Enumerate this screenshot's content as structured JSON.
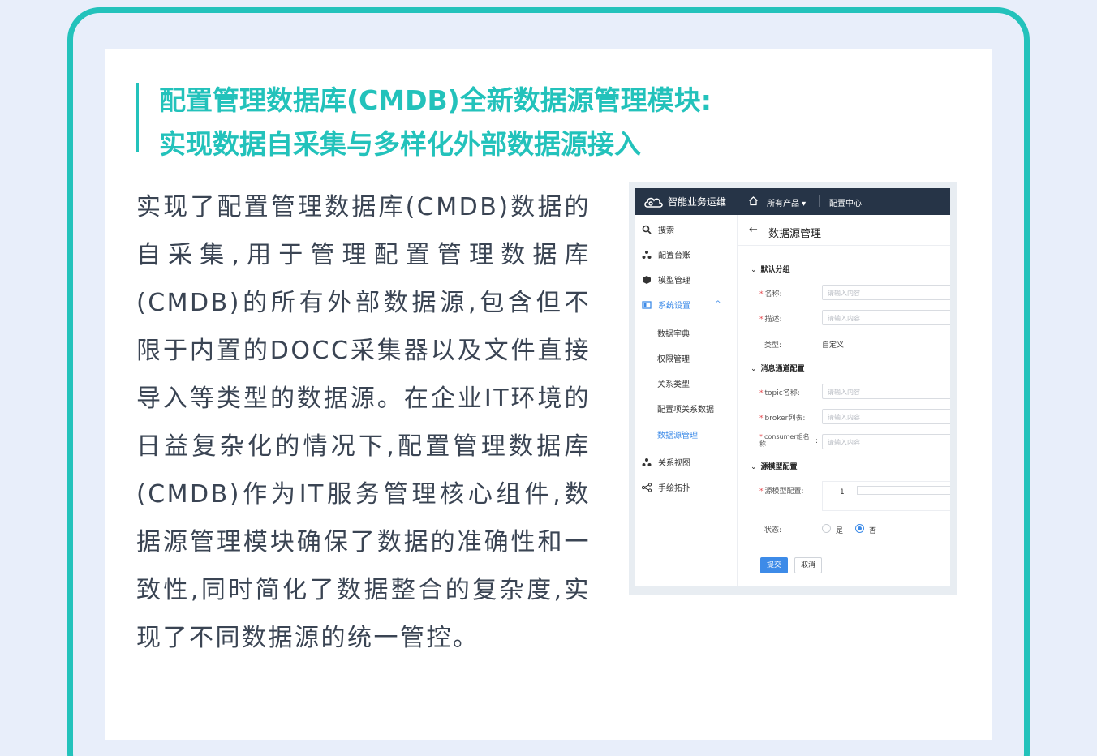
{
  "colors": {
    "accent": "#23c2bb",
    "body_text": "#3a4453",
    "topbar": "#263447",
    "link": "#3d8be8"
  },
  "title": {
    "line1": "配置管理数据库(CMDB)全新数据源管理模块:",
    "line2": "实现数据自采集与多样化外部数据源接入"
  },
  "body": "实现了配置管理数据库(CMDB)数据的自采集,用于管理配置管理数据库(CMDB)的所有外部数据源,包含但不限于内置的DOCC采集器以及文件直接导入等类型的数据源。在企业IT环境的日益复杂化的情况下,配置管理数据库(CMDB)作为IT服务管理核心组件,数据源管理模块确保了数据的准确性和一致性,同时简化了数据整合的复杂度,实现了不同数据源的统一管控。",
  "app": {
    "brand": "智能业务运维",
    "nav": {
      "products": "所有产品 ▾",
      "config_center": "配置中心"
    },
    "sidebar": {
      "search": "搜索",
      "config_ledger": "配置台账",
      "model_mgmt": "模型管理",
      "system_settings": "系统设置",
      "data_dict": "数据字典",
      "perm_mgmt": "权限管理",
      "relation_type": "关系类型",
      "ci_relation_data": "配置项关系数据",
      "datasource_mgmt": "数据源管理",
      "relation_view": "关系视图",
      "hand_topology": "手绘拓扑"
    },
    "page_title": "数据源管理",
    "form": {
      "group_default": "默认分组",
      "name_label": "名称:",
      "desc_label": "描述:",
      "type_label": "类型:",
      "type_value": "自定义",
      "placeholder": "请输入内容",
      "group_msg": "消息通道配置",
      "topic_label": "topic名称:",
      "broker_label": "broker列表:",
      "consumer_label": "consumer组名称",
      "consumer_colon": ":",
      "group_source": "源模型配置",
      "source_label": "源模型配置:",
      "code_line_no": "1",
      "status_label": "状态:",
      "status_yes": "是",
      "status_no": "否",
      "status_selected": "否",
      "submit": "提交",
      "cancel": "取消"
    }
  }
}
